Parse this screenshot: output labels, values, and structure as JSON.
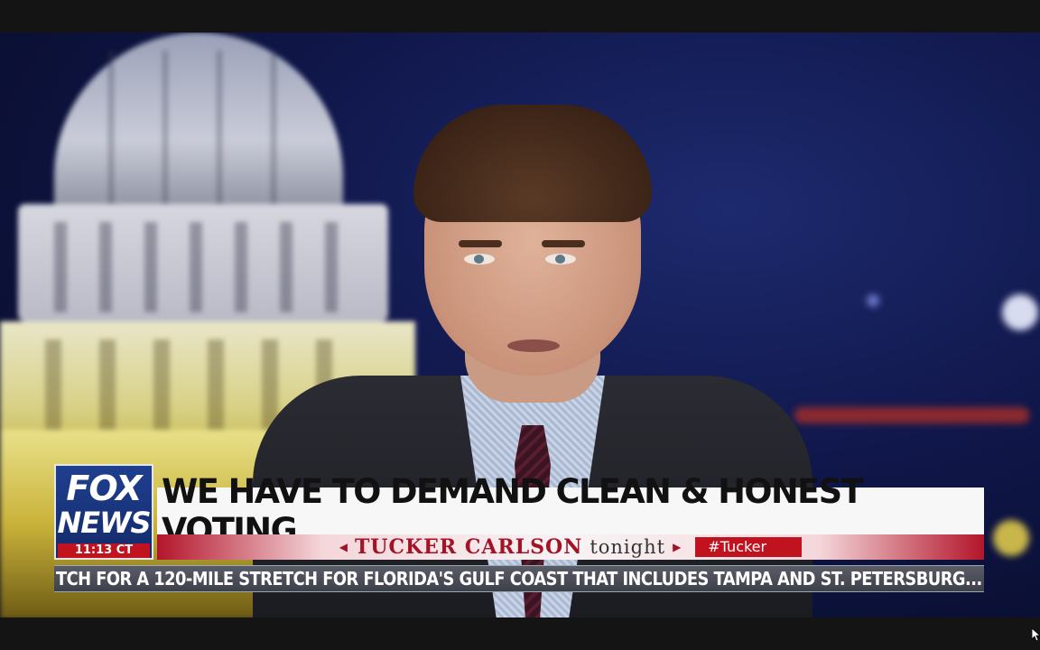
{
  "lower_third": {
    "network_logo_line1": "FOX",
    "network_logo_line2": "NEWS",
    "clock": "11:13 CT",
    "headline": "WE HAVE TO DEMAND CLEAN & HONEST VOTING",
    "show_name": "TUCKER CARLSON",
    "show_suffix": "tonight",
    "hashtag": "#Tucker",
    "ticker": "TCH FOR A 120-MILE STRETCH FOR FLORIDA'S GULF COAST THAT INCLUDES TAMPA AND ST. PETERSBURG..."
  },
  "colors": {
    "brand_red": "#c1121f",
    "fox_blue": "#1f3f8f",
    "background_blue": "#10174a"
  }
}
